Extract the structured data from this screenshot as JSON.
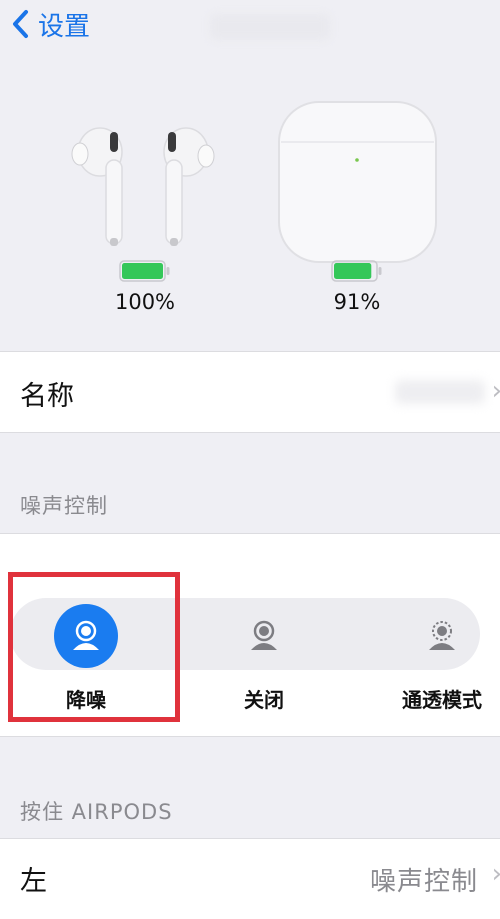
{
  "nav": {
    "back_label": "设置"
  },
  "device": {
    "buds_battery": "100%",
    "case_battery": "91%",
    "buds_battery_level": 1.0,
    "case_battery_level": 0.91,
    "battery_color": "#34c759"
  },
  "name_row": {
    "label": "名称",
    "chevron": "›"
  },
  "noise_control": {
    "header": "噪声控制",
    "options": [
      {
        "label": "降噪",
        "icon": "person-noise-cancel-icon",
        "selected": true
      },
      {
        "label": "关闭",
        "icon": "person-off-icon",
        "selected": false
      },
      {
        "label": "通透模式",
        "icon": "person-transparency-icon",
        "selected": false
      }
    ],
    "accent": "#1a7cf0",
    "highlight_color": "#e0323c"
  },
  "press_hold": {
    "header": "按住 AIRPODS",
    "left_label": "左",
    "left_value": "噪声控制",
    "chevron": "›"
  }
}
